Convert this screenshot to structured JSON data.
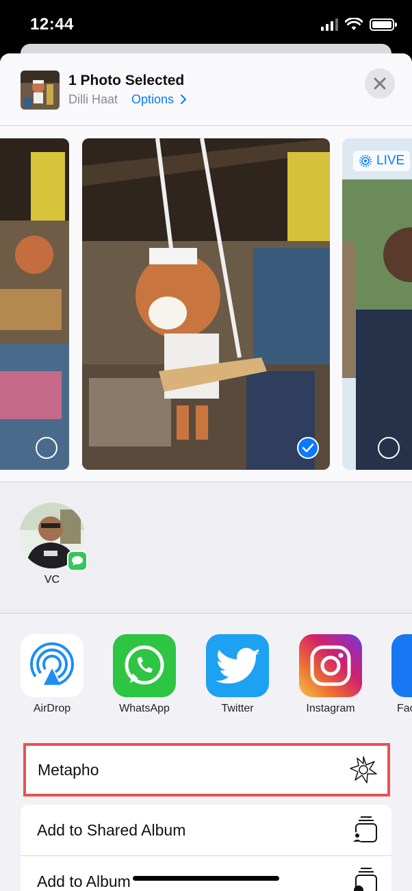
{
  "status_bar": {
    "time": "12:44"
  },
  "share_sheet": {
    "title": "1 Photo Selected",
    "location": "Dilli Haat",
    "options_label": "Options",
    "live_badge": "LIVE",
    "contacts": [
      {
        "name": "VC"
      }
    ],
    "apps": [
      {
        "label": "AirDrop"
      },
      {
        "label": "WhatsApp"
      },
      {
        "label": "Twitter"
      },
      {
        "label": "Instagram"
      },
      {
        "label": "Fac"
      }
    ],
    "actions": [
      {
        "label": "Metapho",
        "icon": "metapho-icon",
        "highlighted": true
      },
      {
        "label": "Add to Shared Album",
        "icon": "shared-album-icon"
      },
      {
        "label": "Add to Album",
        "icon": "add-album-icon"
      }
    ]
  },
  "colors": {
    "accent": "#0a7aff",
    "highlight_border": "#e8524f",
    "sheet_background": "#f2f1f6"
  }
}
